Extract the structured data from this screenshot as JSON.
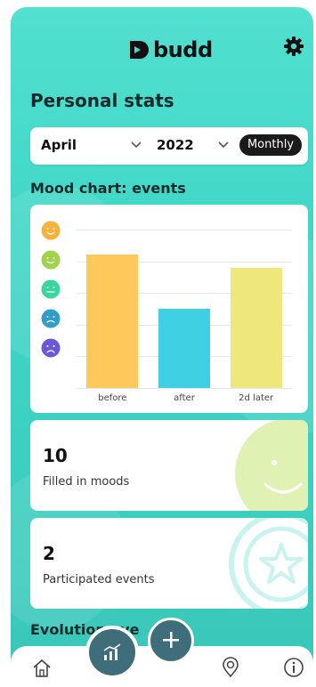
{
  "app": {
    "brand": "budd"
  },
  "page": {
    "title": "Personal stats"
  },
  "filter": {
    "month": "April",
    "year": "2022",
    "period": "Monthly"
  },
  "mood_chart": {
    "title": "Mood chart: events",
    "chart_data": {
      "type": "bar",
      "categories": [
        "before",
        "after",
        "2d later"
      ],
      "values": [
        4.2,
        2.5,
        3.8
      ],
      "ylim": [
        0,
        5
      ],
      "ylabel": "",
      "xlabel": "",
      "grid": true,
      "colors": [
        "#fec95a",
        "#40d0e4",
        "#eee87c"
      ]
    },
    "mood_icons": [
      "very-happy-face-icon",
      "happy-face-icon",
      "neutral-face-icon",
      "sad-face-icon",
      "very-sad-face-icon"
    ],
    "mood_colors": [
      "#f7b23b",
      "#9fd34b",
      "#38d59e",
      "#2f9fc9",
      "#6a58d6"
    ]
  },
  "stats": [
    {
      "value": "10",
      "label": "Filled in moods"
    },
    {
      "value": "2",
      "label": "Participated events"
    }
  ],
  "next_section": {
    "title": "Evolution eve"
  },
  "nav": {
    "items": [
      "home-icon",
      "stats-icon",
      "add-icon",
      "location-icon",
      "info-icon"
    ]
  }
}
